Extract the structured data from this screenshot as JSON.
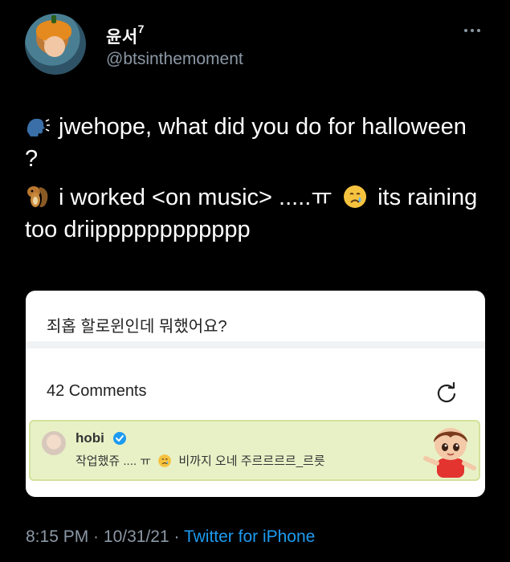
{
  "header": {
    "display_name": "윤서",
    "name_superscript": "7",
    "handle": "@btsinthemoment"
  },
  "tweet": {
    "line1": "jwehope, what did you do for halloween ?",
    "line2_a": "i worked <on music> .....ㅠ",
    "line2_b": "its raining too driipppppppppppp"
  },
  "card": {
    "title": "죄홉 할로윈인데 뭐했어요?",
    "comments_count": "42 Comments",
    "comment": {
      "author": "hobi",
      "text_a": "작업했쥬  .... ㅠ",
      "text_b": "비까지 오네 주르르르르_르릇"
    }
  },
  "footer": {
    "time": "8:15 PM",
    "sep1": " · ",
    "date": "10/31/21",
    "sep2": " · ",
    "source": "Twitter for iPhone"
  },
  "icons": {
    "more": "more-icon",
    "speaking_head": "speaking-head-icon",
    "chipmunk": "chipmunk-icon",
    "crying_face": "crying-face-icon",
    "refresh": "refresh-icon",
    "verified": "verified-icon"
  },
  "colors": {
    "background": "#000000",
    "text": "#ffffff",
    "muted": "#8b98a5",
    "link": "#1d9bf0",
    "comment_highlight": "#e8f1c6",
    "verified": "#1d9bf0"
  }
}
